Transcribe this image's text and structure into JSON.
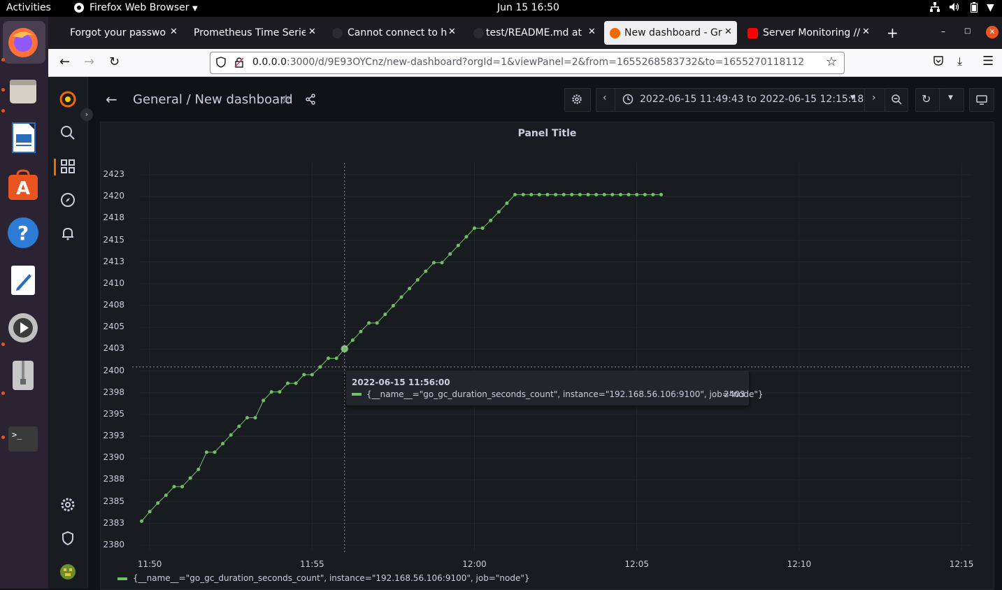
{
  "system_bar": {
    "activities": "Activities",
    "app_name": "Firefox Web Browser",
    "clock": "Jun 15  16:50"
  },
  "browser": {
    "tabs": [
      {
        "label": "Forgot your passwor",
        "icon": "generic-icon",
        "active": false
      },
      {
        "label": "Prometheus Time Series",
        "icon": "prometheus-icon",
        "active": false
      },
      {
        "label": "Cannot connect to ho",
        "icon": "github-icon",
        "active": false
      },
      {
        "label": "test/README.md at",
        "icon": "github-icon",
        "active": false
      },
      {
        "label": "New dashboard - Gra",
        "icon": "grafana-icon",
        "active": true
      },
      {
        "label": "Server Monitoring //",
        "icon": "youtube-icon",
        "active": false
      }
    ],
    "url_host": "0.0.0.0",
    "url_rest": ":3000/d/9E93OYCnz/new-dashboard?orgId=1&viewPanel=2&from=1655268583732&to=1655270118112"
  },
  "grafana": {
    "breadcrumb_folder": "General",
    "breadcrumb_sep": "/",
    "breadcrumb_dashboard": "New dashboard",
    "time_range": "2022-06-15 11:49:43 to 2022-06-15 12:15:18",
    "panel_title": "Panel Title",
    "accent": "#f46800"
  },
  "chart_data": {
    "type": "line",
    "title": "Panel Title",
    "y_ticks": [
      "2423",
      "2420",
      "2418",
      "2415",
      "2413",
      "2410",
      "2408",
      "2405",
      "2403",
      "2400",
      "2398",
      "2395",
      "2393",
      "2390",
      "2388",
      "2385",
      "2383",
      "2380"
    ],
    "x_ticks": [
      "11:50",
      "11:55",
      "12:00",
      "12:05",
      "12:10",
      "12:15"
    ],
    "ylim": [
      2380,
      2423
    ],
    "grid": true,
    "legend_placement": "bottom-left",
    "series": [
      {
        "name": "{__name__=\"go_gc_duration_seconds_count\", instance=\"192.168.56.106:9100\", job=\"node\"}",
        "color": "#73bf69",
        "x": [
          "11:49:45",
          "11:50:00",
          "11:50:15",
          "11:50:30",
          "11:50:45",
          "11:51:00",
          "11:51:15",
          "11:51:30",
          "11:51:45",
          "11:52:00",
          "11:52:15",
          "11:52:30",
          "11:52:45",
          "11:53:00",
          "11:53:15",
          "11:53:30",
          "11:53:45",
          "11:54:00",
          "11:54:15",
          "11:54:30",
          "11:54:45",
          "11:55:00",
          "11:55:15",
          "11:55:30",
          "11:55:45",
          "11:56:00",
          "11:56:15",
          "11:56:30",
          "11:56:45",
          "11:57:00",
          "11:57:15",
          "11:57:30",
          "11:57:45",
          "11:58:00",
          "11:58:15",
          "11:58:30",
          "11:58:45",
          "11:59:00",
          "11:59:15",
          "11:59:30",
          "11:59:45",
          "12:00:00",
          "12:00:15",
          "12:00:30",
          "12:00:45",
          "12:01:00",
          "12:01:15",
          "12:01:30",
          "12:01:45",
          "12:02:00",
          "12:02:15",
          "12:02:30",
          "12:02:45",
          "12:03:00",
          "12:03:15",
          "12:03:30",
          "12:03:45",
          "12:04:00",
          "12:04:15",
          "12:04:30",
          "12:04:45",
          "12:05:00",
          "12:05:15",
          "12:05:30",
          "12:05:45"
        ],
        "values": [
          2382.8,
          2383.9,
          2384.9,
          2385.8,
          2386.8,
          2386.8,
          2387.8,
          2388.8,
          2390.8,
          2390.8,
          2391.8,
          2392.8,
          2393.8,
          2394.8,
          2394.8,
          2396.8,
          2397.8,
          2397.8,
          2398.8,
          2398.8,
          2399.8,
          2399.8,
          2400.7,
          2401.7,
          2401.7,
          2402.8,
          2403.8,
          2404.8,
          2405.8,
          2405.8,
          2406.8,
          2407.8,
          2408.8,
          2409.8,
          2410.8,
          2411.8,
          2412.8,
          2412.8,
          2413.8,
          2414.8,
          2415.8,
          2416.8,
          2416.8,
          2417.7,
          2418.7,
          2419.7,
          2420.7,
          2420.7,
          2420.7,
          2420.7,
          2420.7,
          2420.7,
          2420.7,
          2420.7,
          2420.7,
          2420.7,
          2420.7,
          2420.7,
          2420.7,
          2420.7,
          2420.7,
          2420.7,
          2420.7,
          2420.7,
          2420.7
        ]
      }
    ]
  },
  "tooltip": {
    "time": "2022-06-15 11:56:00",
    "series_label": "{__name__=\"go_gc_duration_seconds_count\", instance=\"192.168.56.106:9100\", job=\"node\"}",
    "value": "2403"
  },
  "legend": {
    "label": "{__name__=\"go_gc_duration_seconds_count\", instance=\"192.168.56.106:9100\", job=\"node\"}"
  }
}
